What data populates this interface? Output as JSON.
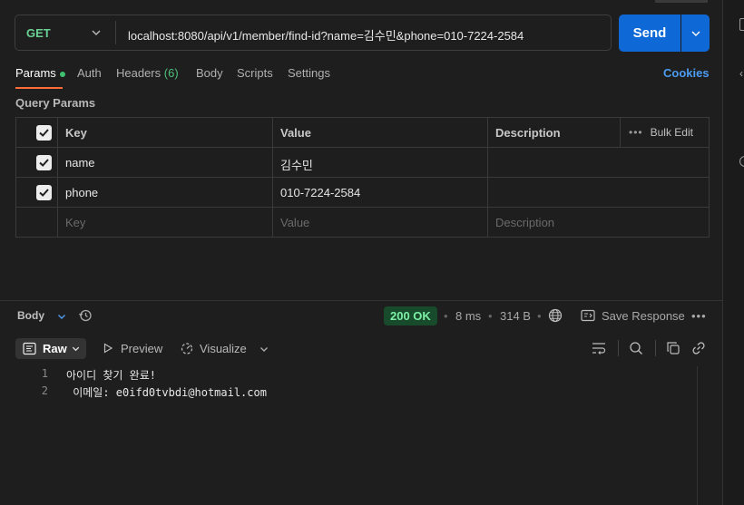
{
  "request": {
    "method": "GET",
    "url": "localhost:8080/api/v1/member/find-id?name=김수민&phone=010-7224-2584",
    "send_label": "Send"
  },
  "tabs": {
    "params": "Params",
    "auth": "Auth",
    "headers": "Headers",
    "headers_count": "(6)",
    "body": "Body",
    "scripts": "Scripts",
    "settings": "Settings",
    "cookies": "Cookies"
  },
  "query_params": {
    "title": "Query Params",
    "columns": {
      "key": "Key",
      "value": "Value",
      "description": "Description",
      "bulk_edit": "Bulk Edit"
    },
    "rows": [
      {
        "key": "name",
        "value": "김수민",
        "description": ""
      },
      {
        "key": "phone",
        "value": "010-7224-2584",
        "description": ""
      }
    ],
    "placeholder": {
      "key": "Key",
      "value": "Value",
      "description": "Description"
    }
  },
  "response": {
    "body_label": "Body",
    "status": "200 OK",
    "time": "8 ms",
    "size": "314 B",
    "save_label": "Save Response",
    "format_label": "Raw",
    "preview_label": "Preview",
    "visualize_label": "Visualize",
    "lines": [
      {
        "num": "1",
        "text": "아이디 찾기 완료!"
      },
      {
        "num": "2",
        "text": " 이메일: e0ifd0tvbdi@hotmail.com"
      }
    ]
  },
  "colors": {
    "accent": "#ff6c37",
    "send": "#0e69d6",
    "method": "#6ad195",
    "status_bg": "#184b2c",
    "status_text": "#7ef0a6",
    "link": "#4c9cf0"
  }
}
